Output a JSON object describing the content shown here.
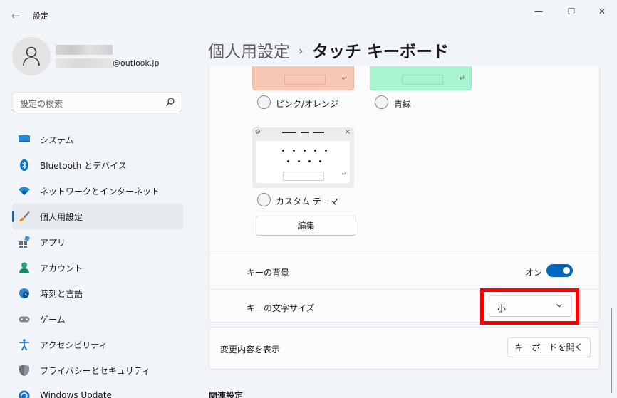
{
  "window": {
    "app_title": "設定",
    "back_glyph": "←",
    "minimize_glyph": "—",
    "maximize_glyph": "☐",
    "close_glyph": "✕"
  },
  "user": {
    "email_suffix": "@outlook.jp"
  },
  "search": {
    "placeholder": "設定の検索"
  },
  "sidebar": {
    "items": [
      {
        "label": "システム",
        "icon": "monitor-icon"
      },
      {
        "label": "Bluetooth とデバイス",
        "icon": "bluetooth-icon"
      },
      {
        "label": "ネットワークとインターネット",
        "icon": "wifi-icon"
      },
      {
        "label": "個人用設定",
        "icon": "brush-icon",
        "selected": true
      },
      {
        "label": "アプリ",
        "icon": "apps-icon"
      },
      {
        "label": "アカウント",
        "icon": "person-icon"
      },
      {
        "label": "時刻と言語",
        "icon": "globe-clock-icon"
      },
      {
        "label": "ゲーム",
        "icon": "gamepad-icon"
      },
      {
        "label": "アクセシビリティ",
        "icon": "accessibility-icon"
      },
      {
        "label": "プライバシーとセキュリティ",
        "icon": "shield-icon"
      },
      {
        "label": "Windows Update",
        "icon": "update-icon"
      }
    ]
  },
  "header": {
    "parent": "個人用設定",
    "separator": "›",
    "current": "タッチ キーボード"
  },
  "themes": {
    "pink_label": "ピンク/オレンジ",
    "green_label": "青緑",
    "custom_label": "カスタム テーマ",
    "enter_glyph": "↵",
    "edit_button": "編集"
  },
  "settings": {
    "key_background": {
      "label": "キーの背景",
      "state": "オン",
      "on": true
    },
    "key_text_size": {
      "label": "キーの文字サイズ",
      "value": "小"
    }
  },
  "preview": {
    "label": "変更内容を表示",
    "button": "キーボードを開く"
  },
  "related": {
    "title": "関連設定"
  },
  "colors": {
    "accent": "#0067c0",
    "pink_theme": "#f8c7b3",
    "green_theme": "#a7f3d2",
    "highlight": "#ff0000"
  }
}
